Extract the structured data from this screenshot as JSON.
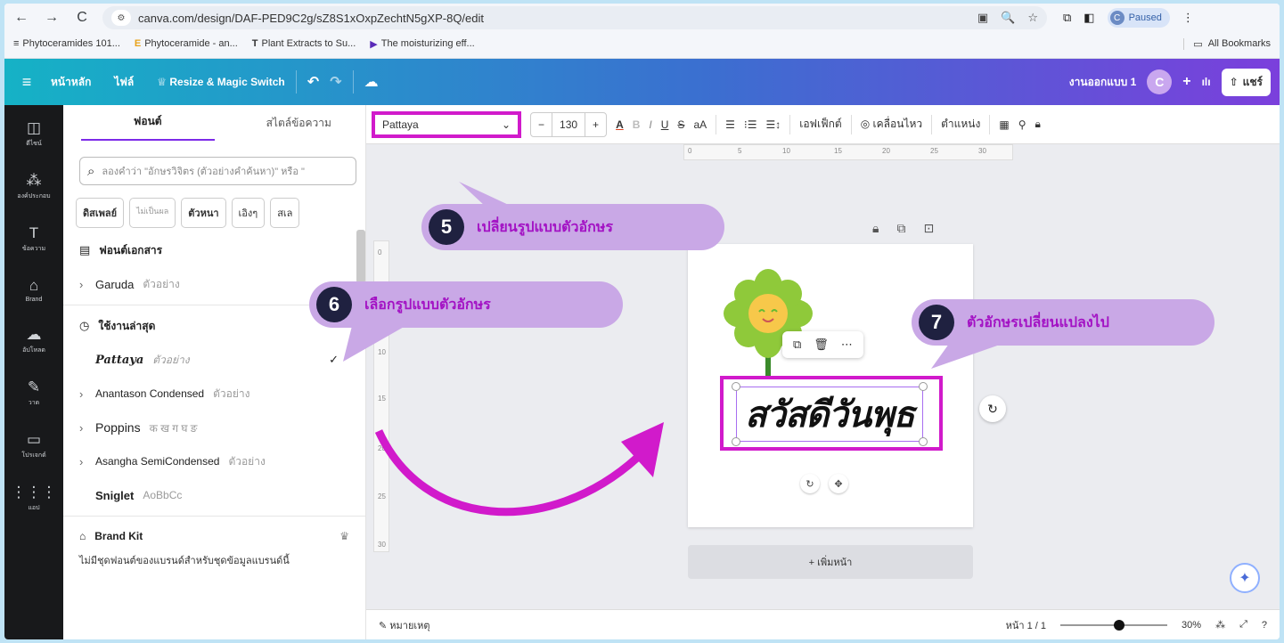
{
  "browser": {
    "url": "canva.com/design/DAF-PED9C2g/sZ8S1xOxpZechtN5gXP-8Q/edit",
    "profile_status": "Paused",
    "profile_initial": "C",
    "bookmarks": [
      {
        "label": "Phytoceramides 101..."
      },
      {
        "label": "Phytoceramide - an..."
      },
      {
        "label": "Plant Extracts to Su..."
      },
      {
        "label": "The moisturizing eff..."
      }
    ],
    "all_bookmarks": "All Bookmarks"
  },
  "topbar": {
    "home": "หน้าหลัก",
    "file": "ไฟล์",
    "resize": "Resize & Magic Switch",
    "doc_title": "งานออกแบบ 1",
    "avatar": "C",
    "share": "แชร์"
  },
  "rail": [
    {
      "label": "ดีไซน์",
      "icon": "layout-icon"
    },
    {
      "label": "องค์ประกอบ",
      "icon": "elements-icon"
    },
    {
      "label": "ข้อความ",
      "icon": "text-icon"
    },
    {
      "label": "Brand",
      "icon": "brand-icon"
    },
    {
      "label": "อัปโหลด",
      "icon": "upload-icon"
    },
    {
      "label": "วาด",
      "icon": "draw-icon"
    },
    {
      "label": "โปรเจกต์",
      "icon": "folder-icon"
    },
    {
      "label": "แอป",
      "icon": "apps-icon"
    }
  ],
  "panel": {
    "tab_font": "ฟอนต์",
    "tab_style": "สไตล์ข้อความ",
    "search_placeholder": "ลองคำว่า \"อักษรวิจิตร (ตัวอย่างคำค้นหา)\" หรือ \"",
    "chips": [
      "ดิสเพลย์",
      "ไม่เป็นผล",
      "ตัวหนา",
      "เอิงๆ",
      "สเล"
    ],
    "doc_fonts_header": "ฟอนต์เอกสาร",
    "garuda": "Garuda",
    "garuda_sample": "ตัวอย่าง",
    "recent_header": "ใช้งานล่าสุด",
    "fonts": [
      {
        "name": "Pattaya",
        "sample": "ตัวอย่าง"
      },
      {
        "name": "Anantason Condensed",
        "sample": "ตัวอย่าง"
      },
      {
        "name": "Poppins",
        "sample": "क ख ग घ ङ"
      },
      {
        "name": "Asangha SemiCondensed",
        "sample": "ตัวอย่าง"
      },
      {
        "name": "Sniglet",
        "sample": "AoBbCc"
      }
    ],
    "brandkit": "Brand Kit",
    "brand_note": "ไม่มีชุดฟอนต์ของแบรนด์สำหรับชุดข้อมูลแบรนด์นี้"
  },
  "toolbar": {
    "font": "Pattaya",
    "size": "130",
    "effects": "เอฟเฟ็กต์",
    "animate": "เคลื่อนไหว",
    "position": "ตำแหน่ง"
  },
  "canvas": {
    "headline": "สวัสดีวันพุธ",
    "add_page": "+ เพิ่มหน้า"
  },
  "bottom": {
    "notes": "หมายเหตุ",
    "page": "หน้า 1 / 1",
    "zoom": "30%"
  },
  "callouts": {
    "c5": {
      "num": "5",
      "text": "เปลี่ยนรูปแบบตัวอักษร"
    },
    "c6": {
      "num": "6",
      "text": "เลือกรูปแบบตัวอักษร"
    },
    "c7": {
      "num": "7",
      "text": "ตัวอักษรเปลี่ยนแปลงไป"
    }
  },
  "colors": {
    "highlight": "#d11acb",
    "callout_bg": "#c9a8e6",
    "callout_text": "#a312c4"
  }
}
